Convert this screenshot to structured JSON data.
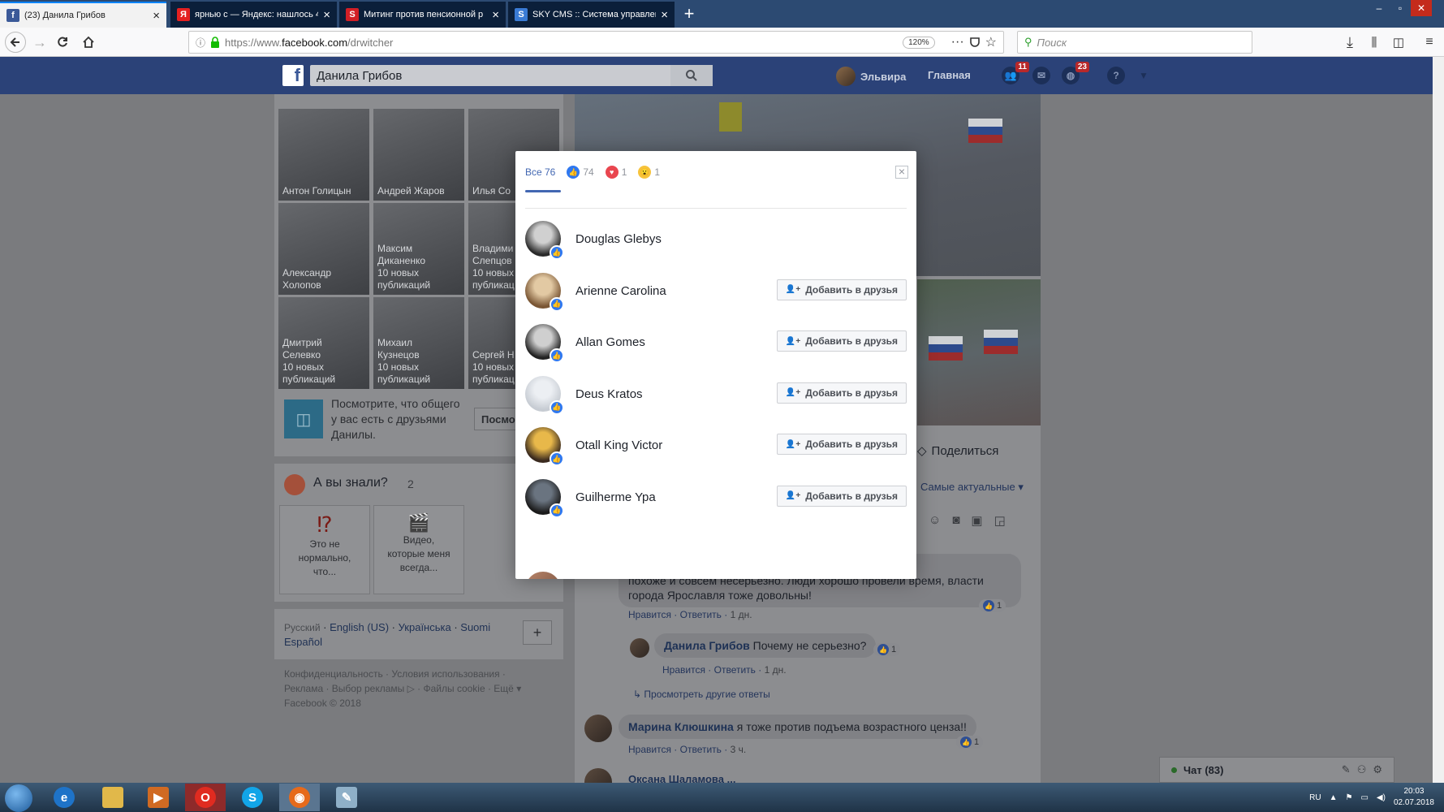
{
  "browser": {
    "tabs": [
      {
        "title": "(23) Данила Грибов",
        "fav": "f",
        "fav_color": "#3b5998",
        "active": true
      },
      {
        "title": "ярнью с — Яндекс: нашлось 4",
        "fav": "Я",
        "fav_color": "#e42020",
        "active": false
      },
      {
        "title": "Митинг против пенсионной р",
        "fav": "S",
        "fav_color": "#d21f26",
        "active": false
      },
      {
        "title": "SKY CMS :: Система управлен",
        "fav": "S",
        "fav_color": "#3a7bd5",
        "active": false
      }
    ],
    "url_prefix": "https://www.",
    "url_host": "facebook.com",
    "url_path": "/drwitcher",
    "zoom": "120%",
    "search_placeholder": "Поиск"
  },
  "fb": {
    "search_value": "Данила Грибов",
    "user_name": "Эльвира",
    "home_label": "Главная",
    "friend_requests_count": "11",
    "notifications_count": "23"
  },
  "left": {
    "friends": [
      {
        "label": "Антон Голицын"
      },
      {
        "label": "Андрей Жаров"
      },
      {
        "label": "Илья Со"
      },
      {
        "label": "Александр\nХолопов"
      },
      {
        "label": "Максим\nДиканенко\n10 новых\nпубликаций"
      },
      {
        "label": "Владими\nСлепцов\n10 новых\nпубликац"
      },
      {
        "label": "Дмитрий\nСелевко\n10 новых\nпубликаций"
      },
      {
        "label": "Михаил\nКузнецов\n10 новых\nпубликаций"
      },
      {
        "label": "Сергей Н\n10 новых\nпубликац"
      }
    ],
    "mutual_text": "Посмотрите, что общего\nу вас есть с друзьями\nДанилы.",
    "mutual_button": "Посмо",
    "didyouknow_title": "А вы знали?",
    "didyouknow_count": "2",
    "dyk_cards": [
      {
        "icon": "⁉",
        "text": "Это не\nнормально,\nчто..."
      },
      {
        "icon": "🎬",
        "text": "Видео,\nкоторые меня\nвсегда..."
      }
    ],
    "languages": [
      "Русский",
      "English (US)",
      "Українська",
      "Suomi",
      "Español"
    ],
    "lang_add": "+",
    "footer_line1": "Конфиденциальность · Условия использования ·",
    "footer_line2": "Реклама · Выбор рекламы ▷ · Файлы cookie · Ещё ▾",
    "footer_copy": "Facebook © 2018"
  },
  "right": {
    "share_label": "Поделиться",
    "sort_label": "Самые актуальные ▾",
    "comments": [
      {
        "name": "",
        "text": "На попсу\nпохоже и совсем несерьезно. Люди хорошо провели время, власти\nгорода Ярославля тоже довольны!",
        "likes": "1",
        "actions": [
          "Нравится",
          "Ответить",
          "1 дн."
        ]
      },
      {
        "name": "Данила Грибов",
        "text": "Почему не серьезно?",
        "likes": "1",
        "actions": [
          "Нравится",
          "Ответить",
          "1 дн."
        ]
      },
      {
        "name": "Марина Клюшкина",
        "text": "я тоже против подъема возрастного ценза!!",
        "likes": "1",
        "actions": [
          "Нравится",
          "Ответить",
          "3 ч."
        ]
      }
    ],
    "more_replies": "Просмотреть другие ответы",
    "next_comment_peek": "Оксана Шаламова ..."
  },
  "chat": {
    "label": "Чат (83)"
  },
  "modal": {
    "tab_all": "Все 76",
    "tab_like_count": "74",
    "tab_love_count": "1",
    "tab_wow_count": "1",
    "add_label": "Добавить в друзья",
    "people": [
      {
        "name": "Douglas Glebys",
        "show_add": false,
        "pic": [
          "#d0d0d0",
          "#2a2a2a"
        ]
      },
      {
        "name": "Arienne Carolina",
        "show_add": true,
        "pic": [
          "#e2c9a3",
          "#7a5634"
        ]
      },
      {
        "name": "Allan Gomes",
        "show_add": true,
        "pic": [
          "#cfcfcf",
          "#222"
        ]
      },
      {
        "name": "Deus Kratos",
        "show_add": true,
        "pic": [
          "#eceff3",
          "#c7ccd3"
        ]
      },
      {
        "name": "Otall King Victor",
        "show_add": true,
        "pic": [
          "#e8b84a",
          "#3a2a1e"
        ]
      },
      {
        "name": "Guilherme Ypa",
        "show_add": true,
        "pic": [
          "#6a7480",
          "#1b1b1b"
        ]
      }
    ]
  },
  "taskbar": {
    "lang": "RU",
    "time": "20:03",
    "date": "02.07.2018"
  },
  "colors": {
    "fb_blue": "#4267b2",
    "like_blue": "#2f78f0",
    "love_red": "#e9464f",
    "wow_yellow": "#f7c33b"
  }
}
